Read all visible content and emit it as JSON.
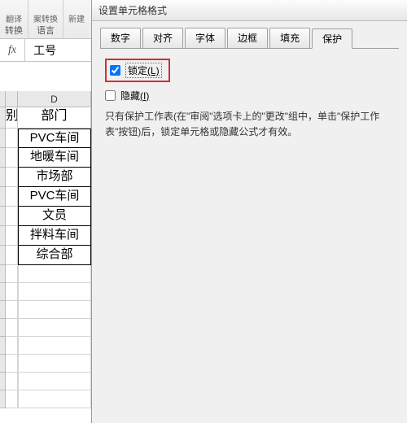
{
  "ribbon": {
    "group1_line1": "翻译",
    "group1_line2": "转换",
    "group2_line1": "案转换",
    "group2_label": "语言",
    "group3_line1": "新建"
  },
  "formula_bar": {
    "fx": "fx",
    "value": "工号"
  },
  "sheet": {
    "col_d": "D",
    "header_c_partial": "别",
    "header_d": "部门",
    "rows": [
      "PVC车间",
      "地暖车间",
      "市场部",
      "PVC车间",
      "文员",
      "拌料车间",
      "综合部"
    ]
  },
  "dialog": {
    "title": "设置单元格格式",
    "tabs": {
      "number": "数字",
      "align": "对齐",
      "font": "字体",
      "border": "边框",
      "fill": "填充",
      "protect": "保护"
    },
    "lock_label": "锁定",
    "lock_key": "(L)",
    "hide_label": "隐藏",
    "hide_key": "(I)",
    "info": "只有保护工作表(在\"审阅\"选项卡上的\"更改\"组中，单击\"保护工作表\"按钮)后，锁定单元格或隐藏公式才有效。"
  }
}
